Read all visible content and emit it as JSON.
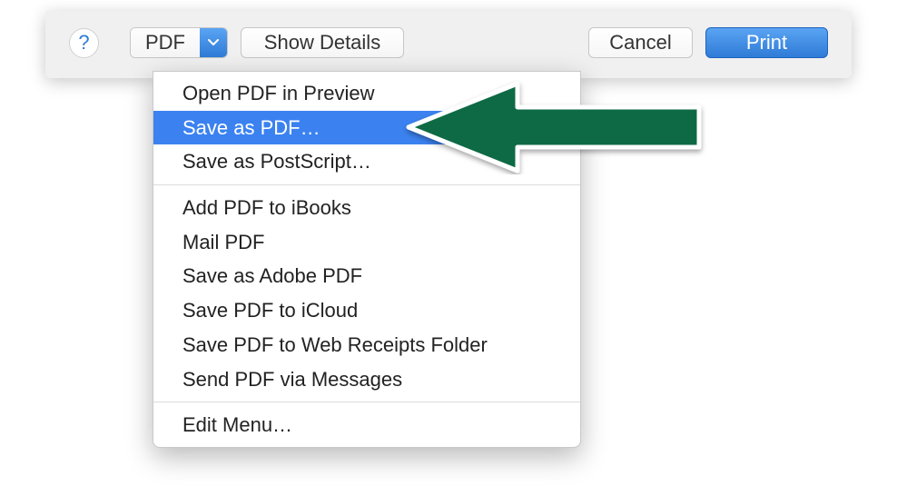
{
  "toolbar": {
    "help": "?",
    "pdf_label": "PDF",
    "show_details": "Show Details",
    "cancel": "Cancel",
    "print": "Print"
  },
  "menu": {
    "group1": [
      "Open PDF in Preview",
      "Save as PDF…",
      "Save as PostScript…"
    ],
    "group2": [
      "Add PDF to iBooks",
      "Mail PDF",
      "Save as Adobe PDF",
      "Save PDF to iCloud",
      "Save PDF to Web Receipts Folder",
      "Send PDF via Messages"
    ],
    "group3": [
      "Edit Menu…"
    ],
    "highlighted_index": 1
  },
  "colors": {
    "accent": "#3b82f0",
    "arrow": "#0b6a44"
  }
}
